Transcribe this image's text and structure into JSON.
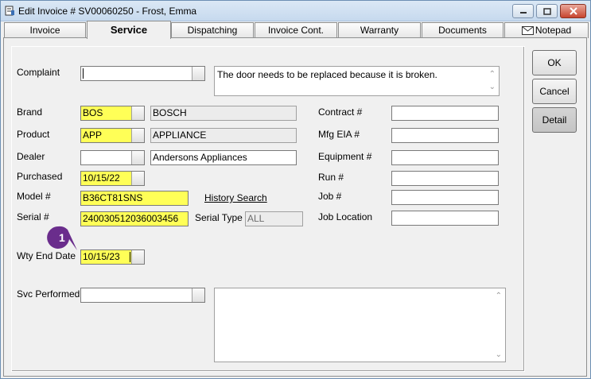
{
  "window": {
    "title": "Edit Invoice # SV00060250  -  Frost, Emma"
  },
  "tabs": [
    {
      "label": "Invoice"
    },
    {
      "label": "Service"
    },
    {
      "label": "Dispatching"
    },
    {
      "label": "Invoice Cont."
    },
    {
      "label": "Warranty"
    },
    {
      "label": "Documents"
    },
    {
      "label": "Notepad"
    }
  ],
  "form": {
    "complaint_label": "Complaint",
    "complaint_code": "",
    "complaint_text": "The door needs to be replaced because it is broken.",
    "brand_label": "Brand",
    "brand_code": "BOS",
    "brand_name": "BOSCH",
    "product_label": "Product",
    "product_code": "APP",
    "product_name": "APPLIANCE",
    "dealer_label": "Dealer",
    "dealer_code": "",
    "dealer_name": "Andersons Appliances",
    "purchased_label": "Purchased",
    "purchased_value": "10/15/22",
    "model_label": "Model #",
    "model_value": "B36CT81SNS",
    "history_search": "History Search",
    "serial_label": "Serial #",
    "serial_value": "240030512036003456",
    "serial_type_label": "Serial Type",
    "serial_type_value": "ALL",
    "wty_end_label": "Wty End Date",
    "wty_end_value": "10/15/23",
    "svc_performed_label": "Svc Performed",
    "svc_performed_value": "",
    "svc_notes": "",
    "contract_label": "Contract #",
    "contract_value": "",
    "mfg_eia_label": "Mfg EIA #",
    "mfg_eia_value": "",
    "equipment_label": "Equipment #",
    "equipment_value": "",
    "run_label": "Run #",
    "run_value": "",
    "job_label": "Job #",
    "job_value": "",
    "job_location_label": "Job Location",
    "job_location_value": ""
  },
  "buttons": {
    "ok": "OK",
    "cancel": "Cancel",
    "detail": "Detail"
  },
  "annotation": {
    "step": "1",
    "color": "#6a2d8c"
  },
  "colors": {
    "required_field": "#ffff57"
  }
}
